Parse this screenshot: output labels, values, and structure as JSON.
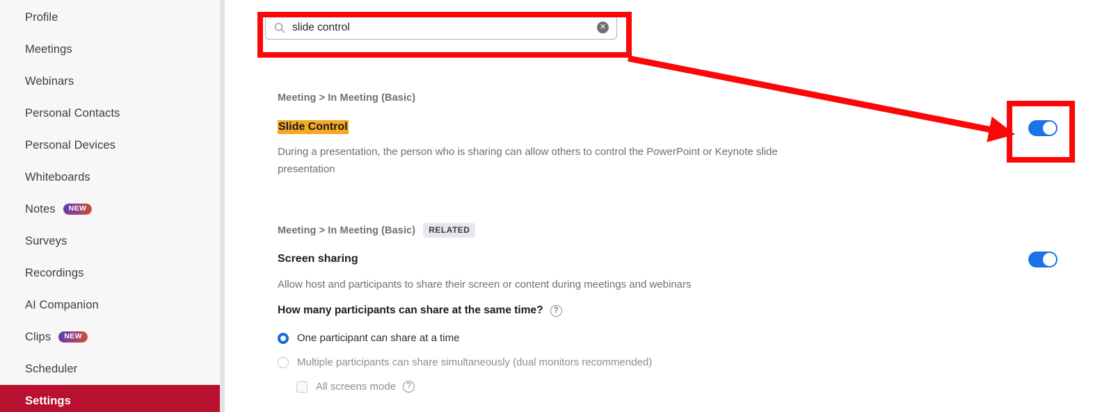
{
  "sidebar": {
    "items": [
      {
        "label": "Profile",
        "badge": null,
        "active": false
      },
      {
        "label": "Meetings",
        "badge": null,
        "active": false
      },
      {
        "label": "Webinars",
        "badge": null,
        "active": false
      },
      {
        "label": "Personal Contacts",
        "badge": null,
        "active": false
      },
      {
        "label": "Personal Devices",
        "badge": null,
        "active": false
      },
      {
        "label": "Whiteboards",
        "badge": null,
        "active": false
      },
      {
        "label": "Notes",
        "badge": "NEW",
        "active": false
      },
      {
        "label": "Surveys",
        "badge": null,
        "active": false
      },
      {
        "label": "Recordings",
        "badge": null,
        "active": false
      },
      {
        "label": "AI Companion",
        "badge": null,
        "active": false
      },
      {
        "label": "Clips",
        "badge": "NEW",
        "active": false
      },
      {
        "label": "Scheduler",
        "badge": null,
        "active": false
      },
      {
        "label": "Settings",
        "badge": null,
        "active": true
      }
    ],
    "active_color": "#b8102f"
  },
  "search": {
    "value": "slide control",
    "placeholder": "Search",
    "icon": "search-icon",
    "clear_icon": "clear-circle-icon",
    "clear_glyph": "✕"
  },
  "results": [
    {
      "breadcrumb": "Meeting > In Meeting (Basic)",
      "related_badge": null,
      "title": "Slide Control",
      "title_highlighted": true,
      "highlight_color": "#f7a824",
      "description": "During a presentation, the person who is sharing can allow others to control the PowerPoint or Keynote slide presentation",
      "toggle_on": true
    },
    {
      "breadcrumb": "Meeting > In Meeting (Basic)",
      "related_badge": "RELATED",
      "title": "Screen sharing",
      "title_highlighted": false,
      "description": "Allow host and participants to share their screen or content during meetings and webinars",
      "toggle_on": true,
      "sub_question": "How many participants can share at the same time?",
      "sub_question_help": "?",
      "options": [
        {
          "label": "One participant can share at a time",
          "type": "radio",
          "checked": true,
          "muted": false
        },
        {
          "label": "Multiple participants can share simultaneously (dual monitors recommended)",
          "type": "radio",
          "checked": false,
          "muted": true
        },
        {
          "label": "All screens mode",
          "type": "checkbox",
          "checked": false,
          "muted": true,
          "help": "?"
        }
      ]
    }
  ],
  "annotations": {
    "color": "#fb0707",
    "search_box_highlight": true,
    "toggle_box_highlight": true,
    "arrow_from": "search-box",
    "arrow_to": "slide-control-toggle"
  },
  "toggle_color_on": "#1a73e8"
}
